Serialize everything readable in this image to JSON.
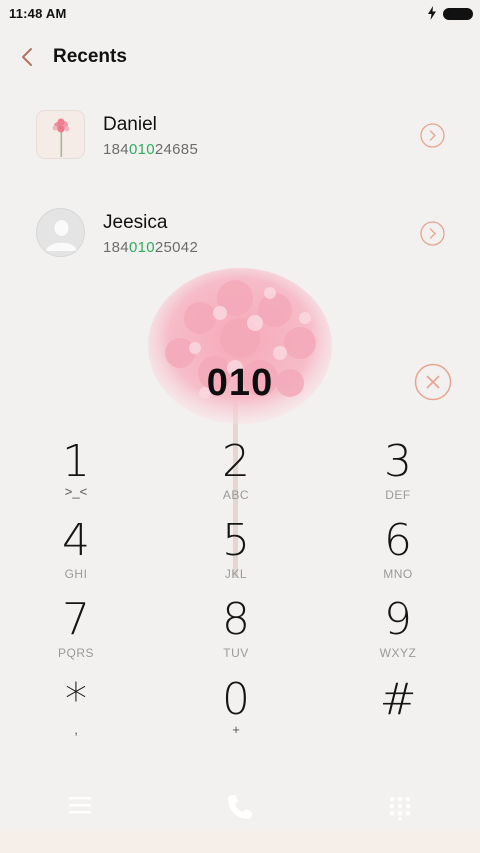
{
  "status_bar": {
    "time": "11:48 AM",
    "icons": [
      "charging-bolt-icon",
      "battery-full-icon"
    ]
  },
  "header": {
    "title": "Recents",
    "back_icon": "chevron-left-icon"
  },
  "recents": [
    {
      "name": "Daniel",
      "number_prefix": "184",
      "number_match": "010",
      "number_suffix": "24685",
      "avatar": "flower-photo",
      "action_icon": "chevron-right-circle-icon"
    },
    {
      "name": "Jeesica",
      "number_prefix": "184",
      "number_match": "010",
      "number_suffix": "25042",
      "avatar": "default-person-icon",
      "action_icon": "chevron-right-circle-icon"
    }
  ],
  "dialer": {
    "input": "010",
    "clear_icon": "close-circle-icon"
  },
  "keypad": [
    {
      "digit": "1",
      "letters": ">_<"
    },
    {
      "digit": "2",
      "letters": "ABC"
    },
    {
      "digit": "3",
      "letters": "DEF"
    },
    {
      "digit": "4",
      "letters": "GHI"
    },
    {
      "digit": "5",
      "letters": "JKL"
    },
    {
      "digit": "6",
      "letters": "MNO"
    },
    {
      "digit": "7",
      "letters": "PQRS"
    },
    {
      "digit": "8",
      "letters": "TUV"
    },
    {
      "digit": "9",
      "letters": "WXYZ"
    },
    {
      "digit": "*",
      "letters": ","
    },
    {
      "digit": "0",
      "letters": "+"
    },
    {
      "digit": "#",
      "letters": ""
    }
  ],
  "bottom_bar": {
    "icons": [
      "menu-icon",
      "phone-call-icon",
      "dialpad-icon"
    ]
  },
  "colors": {
    "background": "#f2f1f0",
    "accent": "#e8a48f",
    "match_highlight": "#2fae5f",
    "flower_pink": "#f5b5c3"
  }
}
